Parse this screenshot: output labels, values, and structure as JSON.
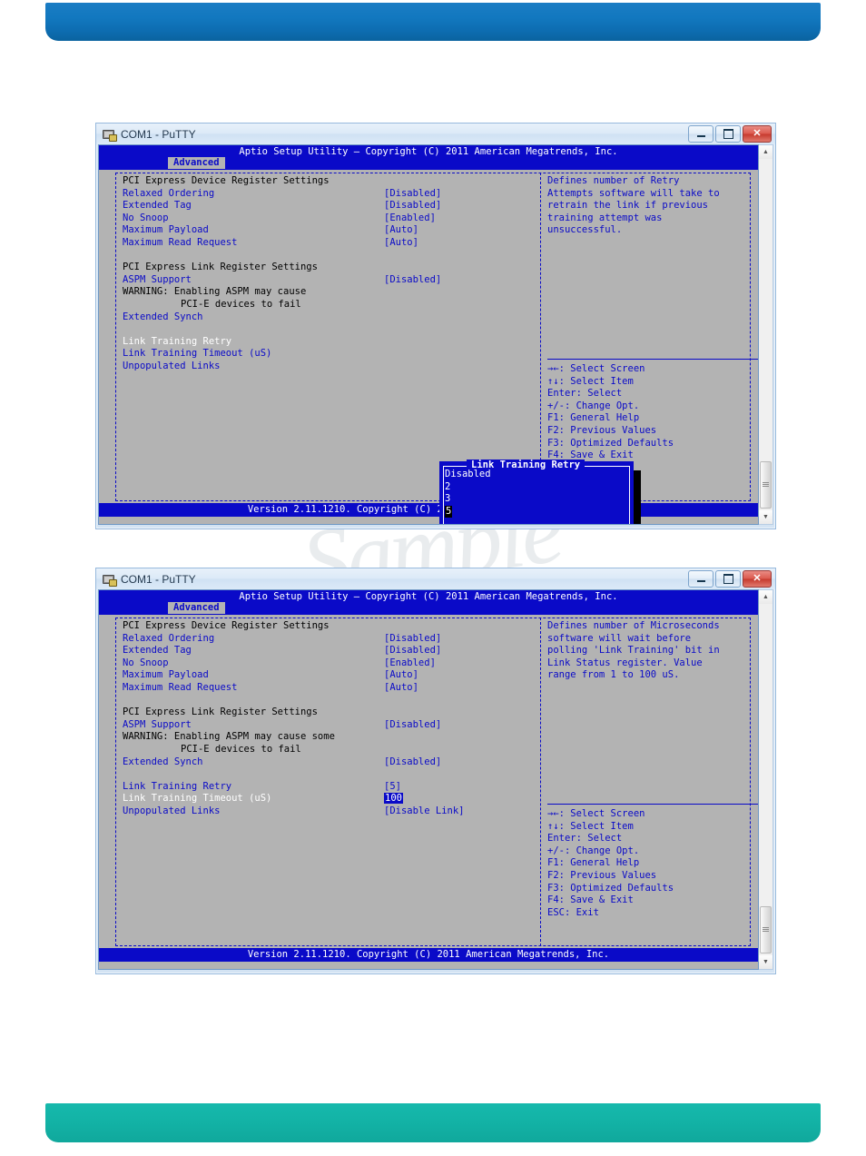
{
  "page": {
    "watermark": "Sample"
  },
  "window": {
    "title": "COM1 - PuTTY",
    "icon": "putty-terminal-icon",
    "minimize_label": "",
    "maximize_label": "",
    "close_label": "✕"
  },
  "bios": {
    "header_title": "Aptio Setup Utility – Copyright (C) 2011 American Megatrends, Inc.",
    "tab": "Advanced",
    "footer": "Version 2.11.1210. Copyright (C) 2011 American Megatrends, Inc.",
    "section_device": "PCI Express Device Register Settings",
    "section_link": "PCI Express Link Register Settings",
    "warning_line1": "WARNING: Enabling ASPM may cause some",
    "warning_line1_short": "WARNING: Enabling ASPM may cause",
    "warning_line2": "PCI-E devices to fail",
    "items": {
      "relaxed_ordering": "Relaxed Ordering",
      "extended_tag": "Extended Tag",
      "no_snoop": "No Snoop",
      "maximum_payload": "Maximum Payload",
      "maximum_read_request": "Maximum Read Request",
      "aspm_support": "ASPM Support",
      "extended_synch": "Extended Synch",
      "link_training_retry": "Link Training Retry",
      "link_training_timeout": "Link Training Timeout (uS)",
      "unpopulated_links": "Unpopulated Links"
    },
    "values": {
      "relaxed_ordering": "[Disabled]",
      "extended_tag": "[Disabled]",
      "no_snoop": "[Enabled]",
      "maximum_payload": "[Auto]",
      "maximum_read_request": "[Auto]",
      "aspm_support": "[Disabled]",
      "extended_synch": "[Disabled]",
      "link_training_retry": "[5]",
      "link_training_timeout": "100",
      "unpopulated_links": "[Disable Link]"
    },
    "keys": [
      "→←: Select Screen",
      "↑↓: Select Item",
      "Enter: Select",
      "+/-: Change Opt.",
      "F1: General Help",
      "F2: Previous Values",
      "F3: Optimized Defaults",
      "F4: Save & Exit",
      "ESC: Exit"
    ]
  },
  "screen1": {
    "help": [
      "Defines number of Retry",
      "Attempts software will take to",
      "retrain the link if previous",
      "training attempt was",
      "unsuccessful."
    ],
    "popup": {
      "title": "Link Training Retry",
      "options": [
        "Disabled",
        "2",
        "3",
        "5"
      ],
      "selected": "5"
    }
  },
  "screen2": {
    "help": [
      "Defines number of Microseconds",
      "software will wait before",
      "polling 'Link Training' bit in",
      "Link Status register. Value",
      "range from 1 to 100 uS."
    ]
  },
  "colors": {
    "bios_blue": "#0a0ac8",
    "bios_gray": "#b3b3b3",
    "banner_top": "#1278bf",
    "banner_bottom": "#13b3a6"
  }
}
